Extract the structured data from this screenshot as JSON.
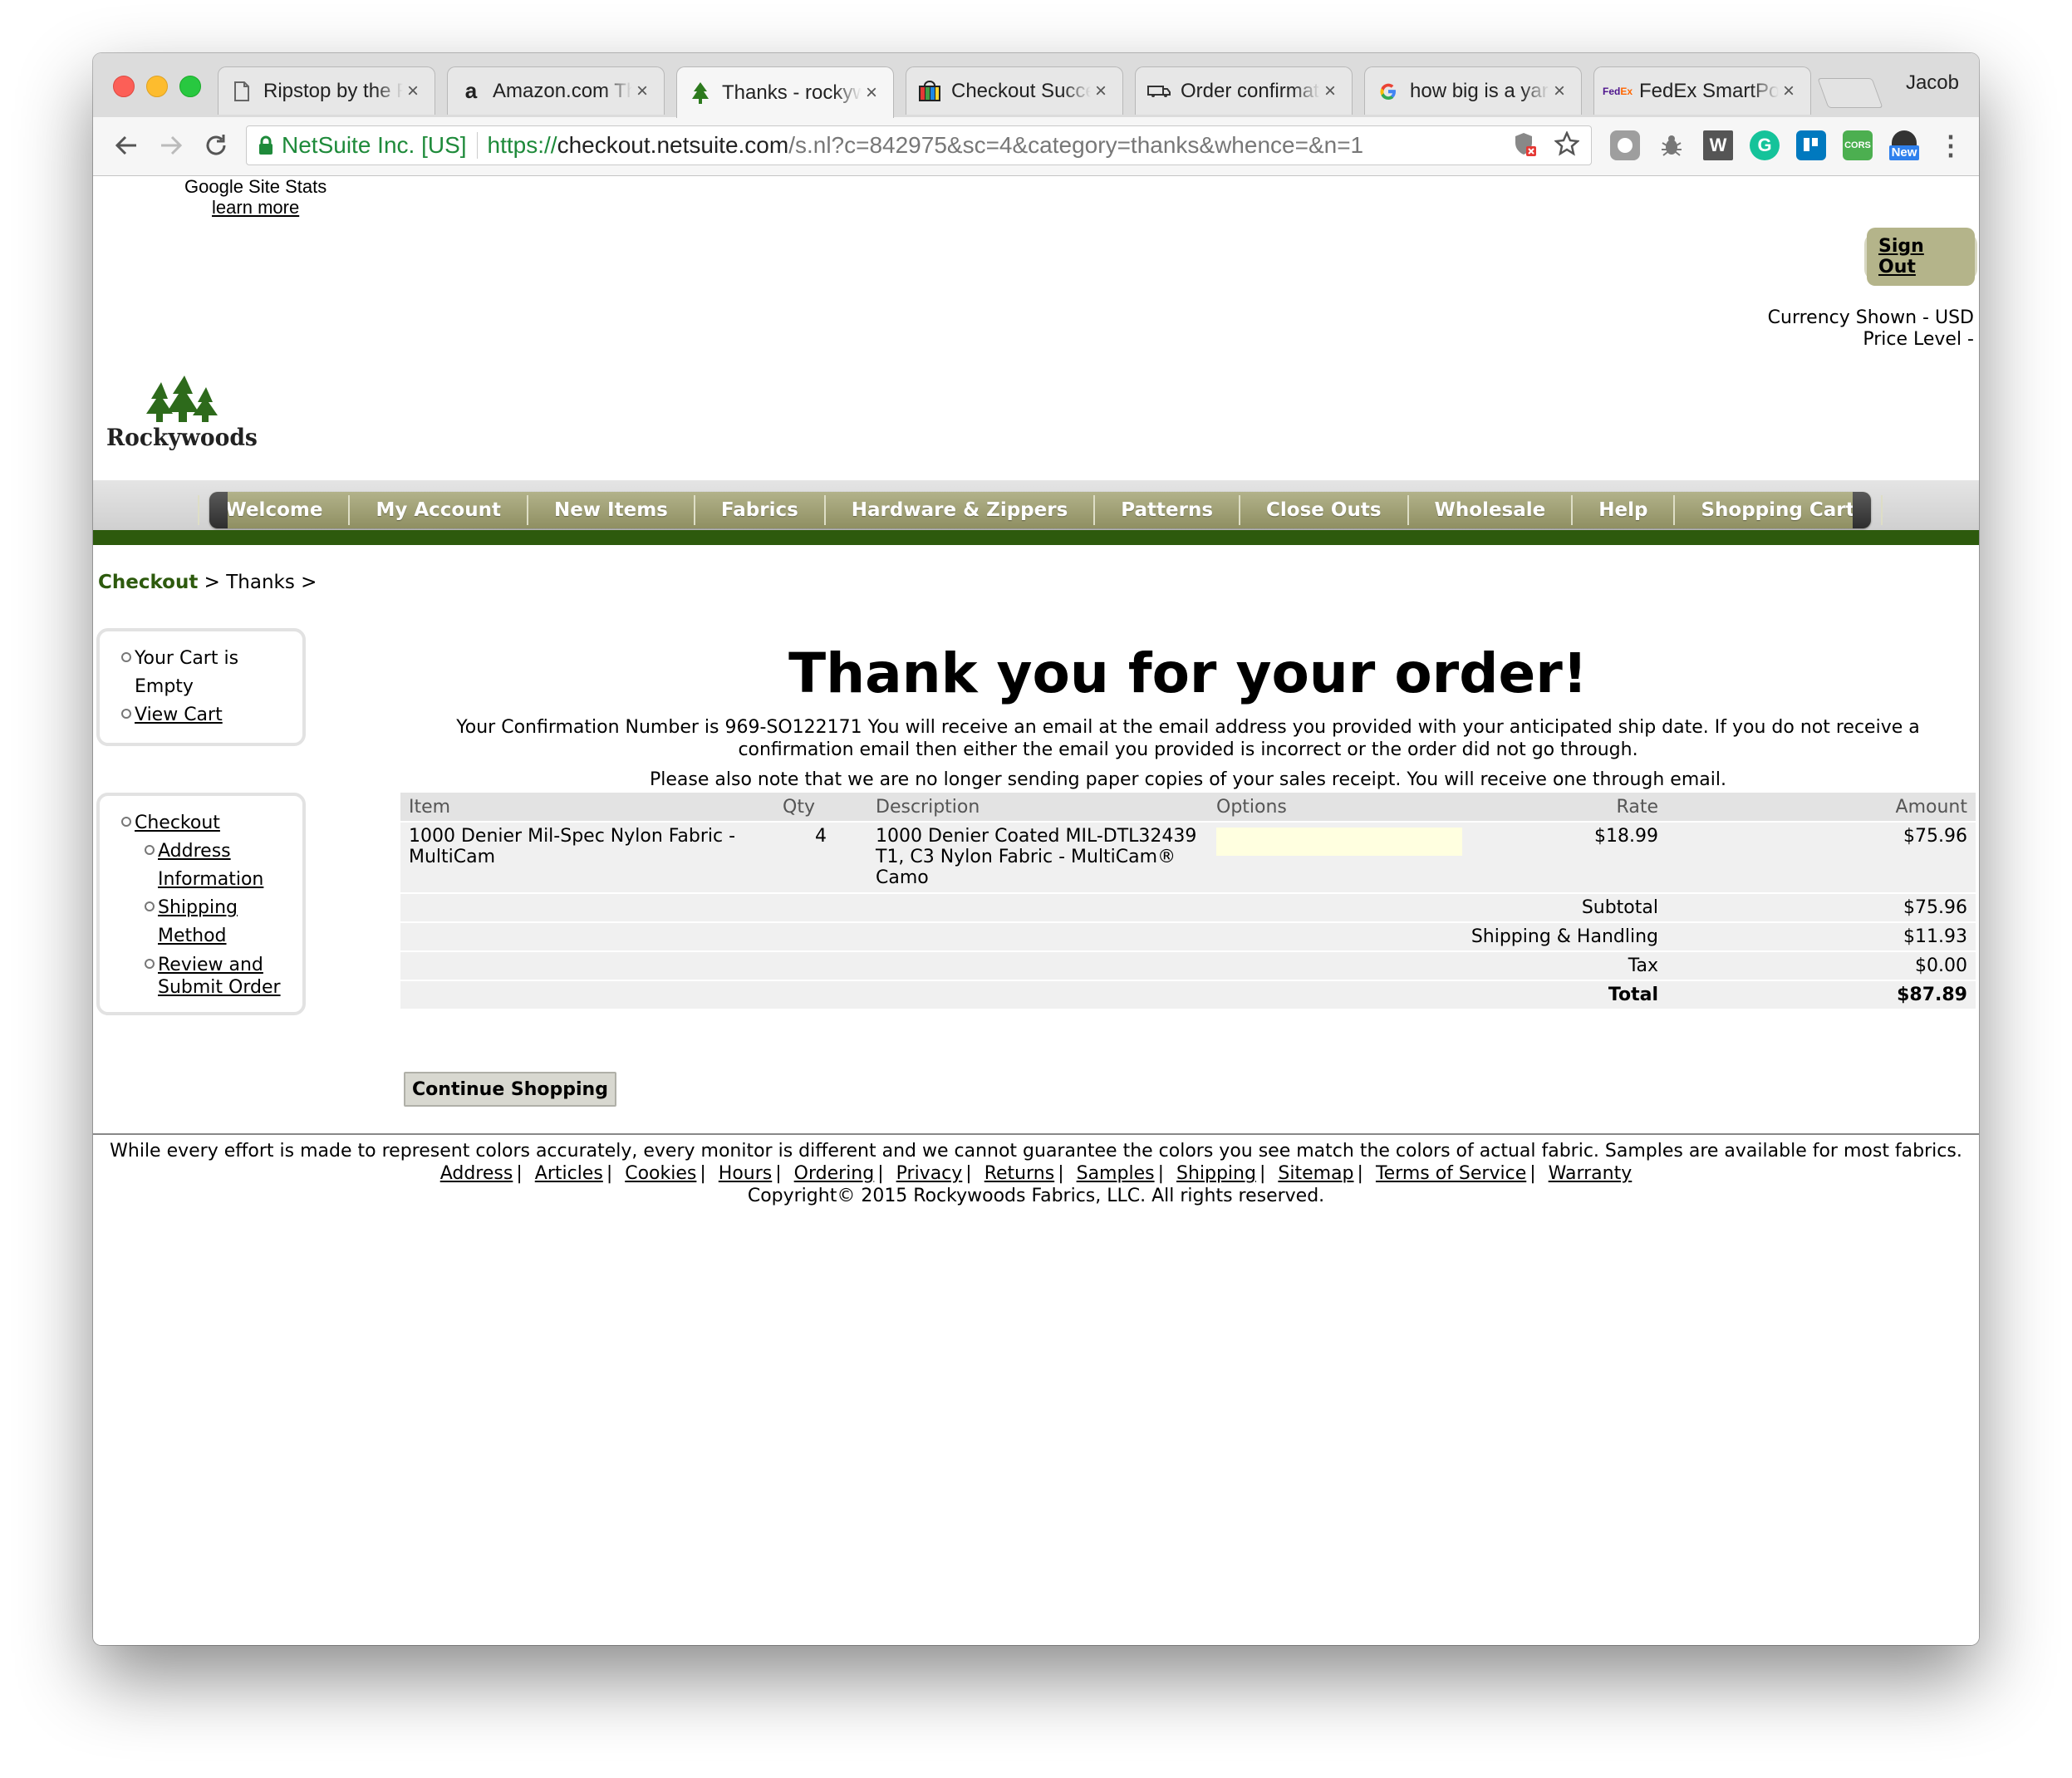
{
  "browser": {
    "tabs": [
      {
        "title": "Ripstop by the Roll",
        "icon": "page-icon"
      },
      {
        "title": "Amazon.com Thank You",
        "icon": "amazon-icon"
      },
      {
        "title": "Thanks - rockywoods",
        "icon": "tree-icon",
        "active": true
      },
      {
        "title": "Checkout Success",
        "icon": "store-icon"
      },
      {
        "title": "Order confirmation",
        "icon": "truck-icon"
      },
      {
        "title": "how big is a yard",
        "icon": "google-icon"
      },
      {
        "title": "FedEx SmartPost",
        "icon": "fedex-icon"
      }
    ],
    "profile": "Jacob",
    "secure_label": "NetSuite Inc. [US]",
    "url_scheme": "https://",
    "url_host": "checkout.netsuite.com",
    "url_path": "/s.nl?c=842975&sc=4&category=thanks&whence=&n=1",
    "extension_new_badge": "New"
  },
  "google_stats": {
    "title": "Google Site Stats",
    "link": "learn more"
  },
  "sign_out": "Sign Out",
  "currency": {
    "shown": "Currency Shown - USD",
    "price_level": "Price Level -"
  },
  "logo_text": "Rockywoods",
  "nav": [
    "Welcome",
    "My Account",
    "New Items",
    "Fabrics",
    "Hardware & Zippers",
    "Patterns",
    "Close Outs",
    "Wholesale",
    "Help",
    "Shopping Cart"
  ],
  "breadcrumb": {
    "checkout": "Checkout",
    "sep": ">",
    "thanks": "Thanks"
  },
  "cart_box": {
    "empty": "Your Cart is Empty",
    "view": "View Cart"
  },
  "checkout_box": {
    "checkout": "Checkout",
    "address": "Address Information",
    "shipping": "Shipping Method",
    "review": "Review and Submit Order"
  },
  "thanks_heading": "Thank you for your order!",
  "confirmation_text": "Your Confirmation Number is 969-SO122171  You will receive an email at the email address you provided with your anticipated ship date. If you do not receive a confirmation email then either the email you provided is incorrect or the order did not go through.",
  "paper_note": "Please also note that we are no longer sending paper copies of your sales receipt. You will receive one through email.",
  "order_table": {
    "headers": {
      "item": "Item",
      "qty": "Qty",
      "description": "Description",
      "options": "Options",
      "rate": "Rate",
      "amount": "Amount"
    },
    "row": {
      "item": "1000 Denier Mil-Spec Nylon Fabric - MultiCam",
      "qty": "4",
      "description": "1000 Denier Coated MIL-DTL32439 T1, C3 Nylon Fabric - MultiCam® Camo",
      "rate": "$18.99",
      "amount": "$75.96"
    },
    "subtotal_label": "Subtotal",
    "subtotal": "$75.96",
    "shipping_label": "Shipping & Handling",
    "shipping": "$11.93",
    "tax_label": "Tax",
    "tax": "$0.00",
    "total_label": "Total",
    "total": "$87.89"
  },
  "continue_button": "Continue Shopping",
  "footer": {
    "disclaimer": "While every effort is made to represent colors accurately, every monitor is different and we cannot guarantee the colors you see match the colors of actual fabric. Samples are available for most fabrics.",
    "links": [
      "Address",
      "Articles",
      "Cookies",
      "Hours",
      "Ordering",
      "Privacy",
      "Returns",
      "Samples",
      "Shipping",
      "Sitemap",
      "Terms of Service",
      "Warranty"
    ],
    "copyright": "Copyright© 2015 Rockywoods Fabrics, LLC.  All rights reserved."
  },
  "colors": {
    "brand_green": "#2d5a0d",
    "nav_olive": "#9f9f74",
    "secure_green": "#1e8a3a"
  }
}
